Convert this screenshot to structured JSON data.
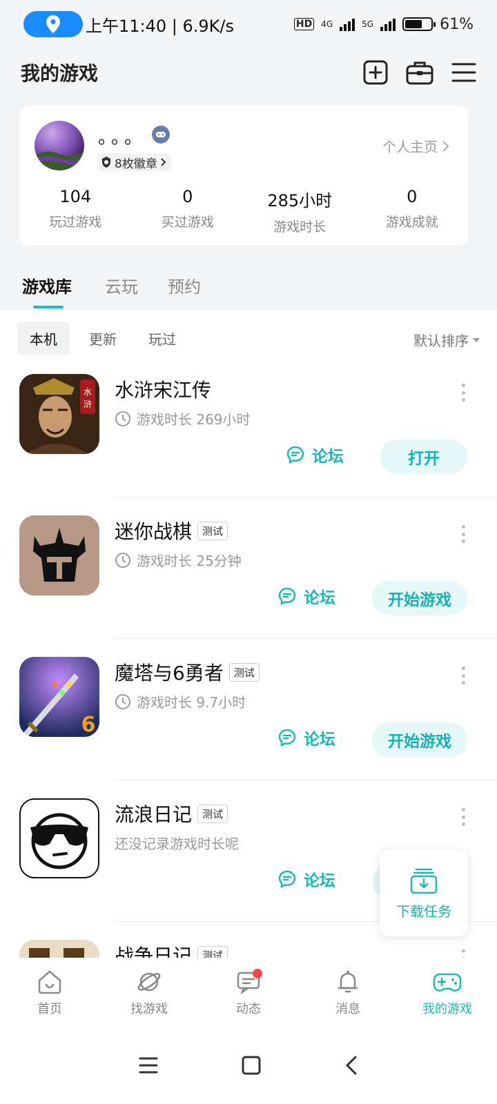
{
  "status_bar": {
    "time_speed": "上午11:40 | 6.9K/s",
    "network_1": "4G",
    "network_2": "5G",
    "battery": "61%"
  },
  "header": {
    "title": "我的游戏",
    "icons": [
      "add-icon",
      "toolbox-icon",
      "menu-icon"
    ]
  },
  "profile": {
    "username": "。。。",
    "badges": "8枚徽章",
    "home_link": "个人主页",
    "stats": [
      {
        "value": "104",
        "label": "玩过游戏"
      },
      {
        "value": "0",
        "label": "买过游戏"
      },
      {
        "value": "285小时",
        "label": "游戏时长"
      },
      {
        "value": "0",
        "label": "游戏成就"
      }
    ]
  },
  "tabs": [
    "游戏库",
    "云玩",
    "预约"
  ],
  "filters": [
    "本机",
    "更新",
    "玩过"
  ],
  "sort_label": "默认排序",
  "games": [
    {
      "name": "水浒宋江传",
      "tag": "",
      "time": "游戏时长 269小时",
      "forum": "论坛",
      "action": "打开"
    },
    {
      "name": "迷你战棋",
      "tag": "测试",
      "time": "游戏时长 25分钟",
      "forum": "论坛",
      "action": "开始游戏"
    },
    {
      "name": "魔塔与6勇者",
      "tag": "测试",
      "time": "游戏时长 9.7小时",
      "forum": "论坛",
      "action": "开始游戏"
    },
    {
      "name": "流浪日记",
      "tag": "测试",
      "time": "还没记录游戏时长呢",
      "forum": "论坛",
      "action": ""
    },
    {
      "name": "战争日记",
      "tag": "测试",
      "time": "",
      "forum": "",
      "action": ""
    }
  ],
  "download_task": "下载任务",
  "bottom_nav": [
    "首页",
    "找游戏",
    "动态",
    "消息",
    "我的游戏"
  ],
  "colors": {
    "accent": "#1cb5b8",
    "accent_bg": "#e5f7f7",
    "location_pill": "#1a8cff",
    "notification": "#f04848"
  }
}
